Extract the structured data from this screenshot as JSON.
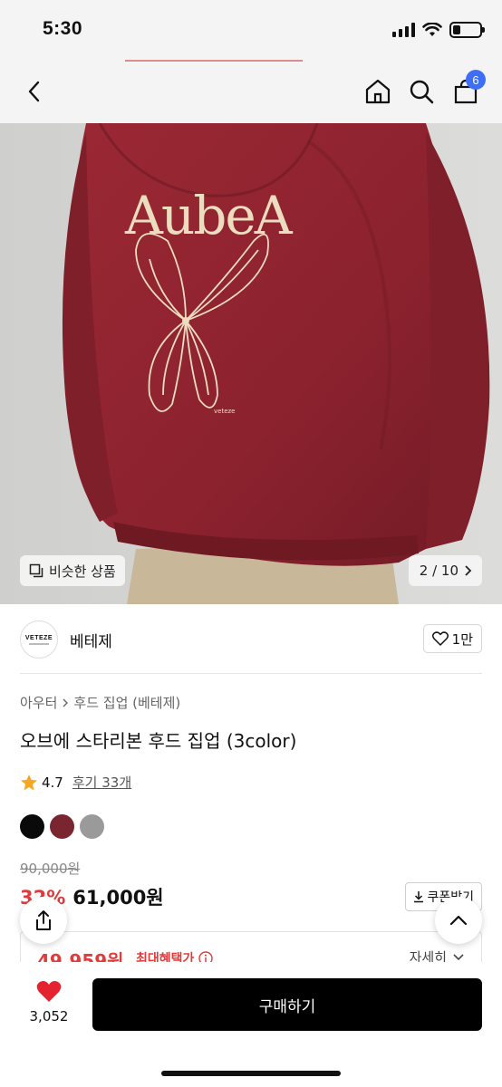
{
  "status": {
    "time": "5:30"
  },
  "nav": {
    "cart_count": "6"
  },
  "hero": {
    "print_text": "AubeA",
    "similar_label": "비슷한 상품",
    "page_indicator": "2 / 10"
  },
  "brand": {
    "logo_text": "VETEZE",
    "name": "베테제",
    "likes": "1만"
  },
  "product": {
    "breadcrumb": [
      "아우터",
      "후드 집업 (베테제)"
    ],
    "title": "오브에 스타리본 후드 집업 (3color)",
    "rating": "4.7",
    "reviews": "후기 33개",
    "colors": [
      "#0a0a0a",
      "#7a2630",
      "#9a9a9a"
    ]
  },
  "price": {
    "original": "90,000원",
    "discount": "32%",
    "current": "61,000원",
    "coupon_label": "쿠폰받기",
    "max_benefit_price": "49,959원",
    "max_benefit_label": "최대혜택가",
    "detail_label": "자세히"
  },
  "bottom": {
    "wish_count": "3,052",
    "buy_label": "구매하기"
  },
  "colors": {
    "accent_red": "#e23b3b",
    "badge_blue": "#3d6ef5",
    "hoodie": "#8e2330"
  }
}
